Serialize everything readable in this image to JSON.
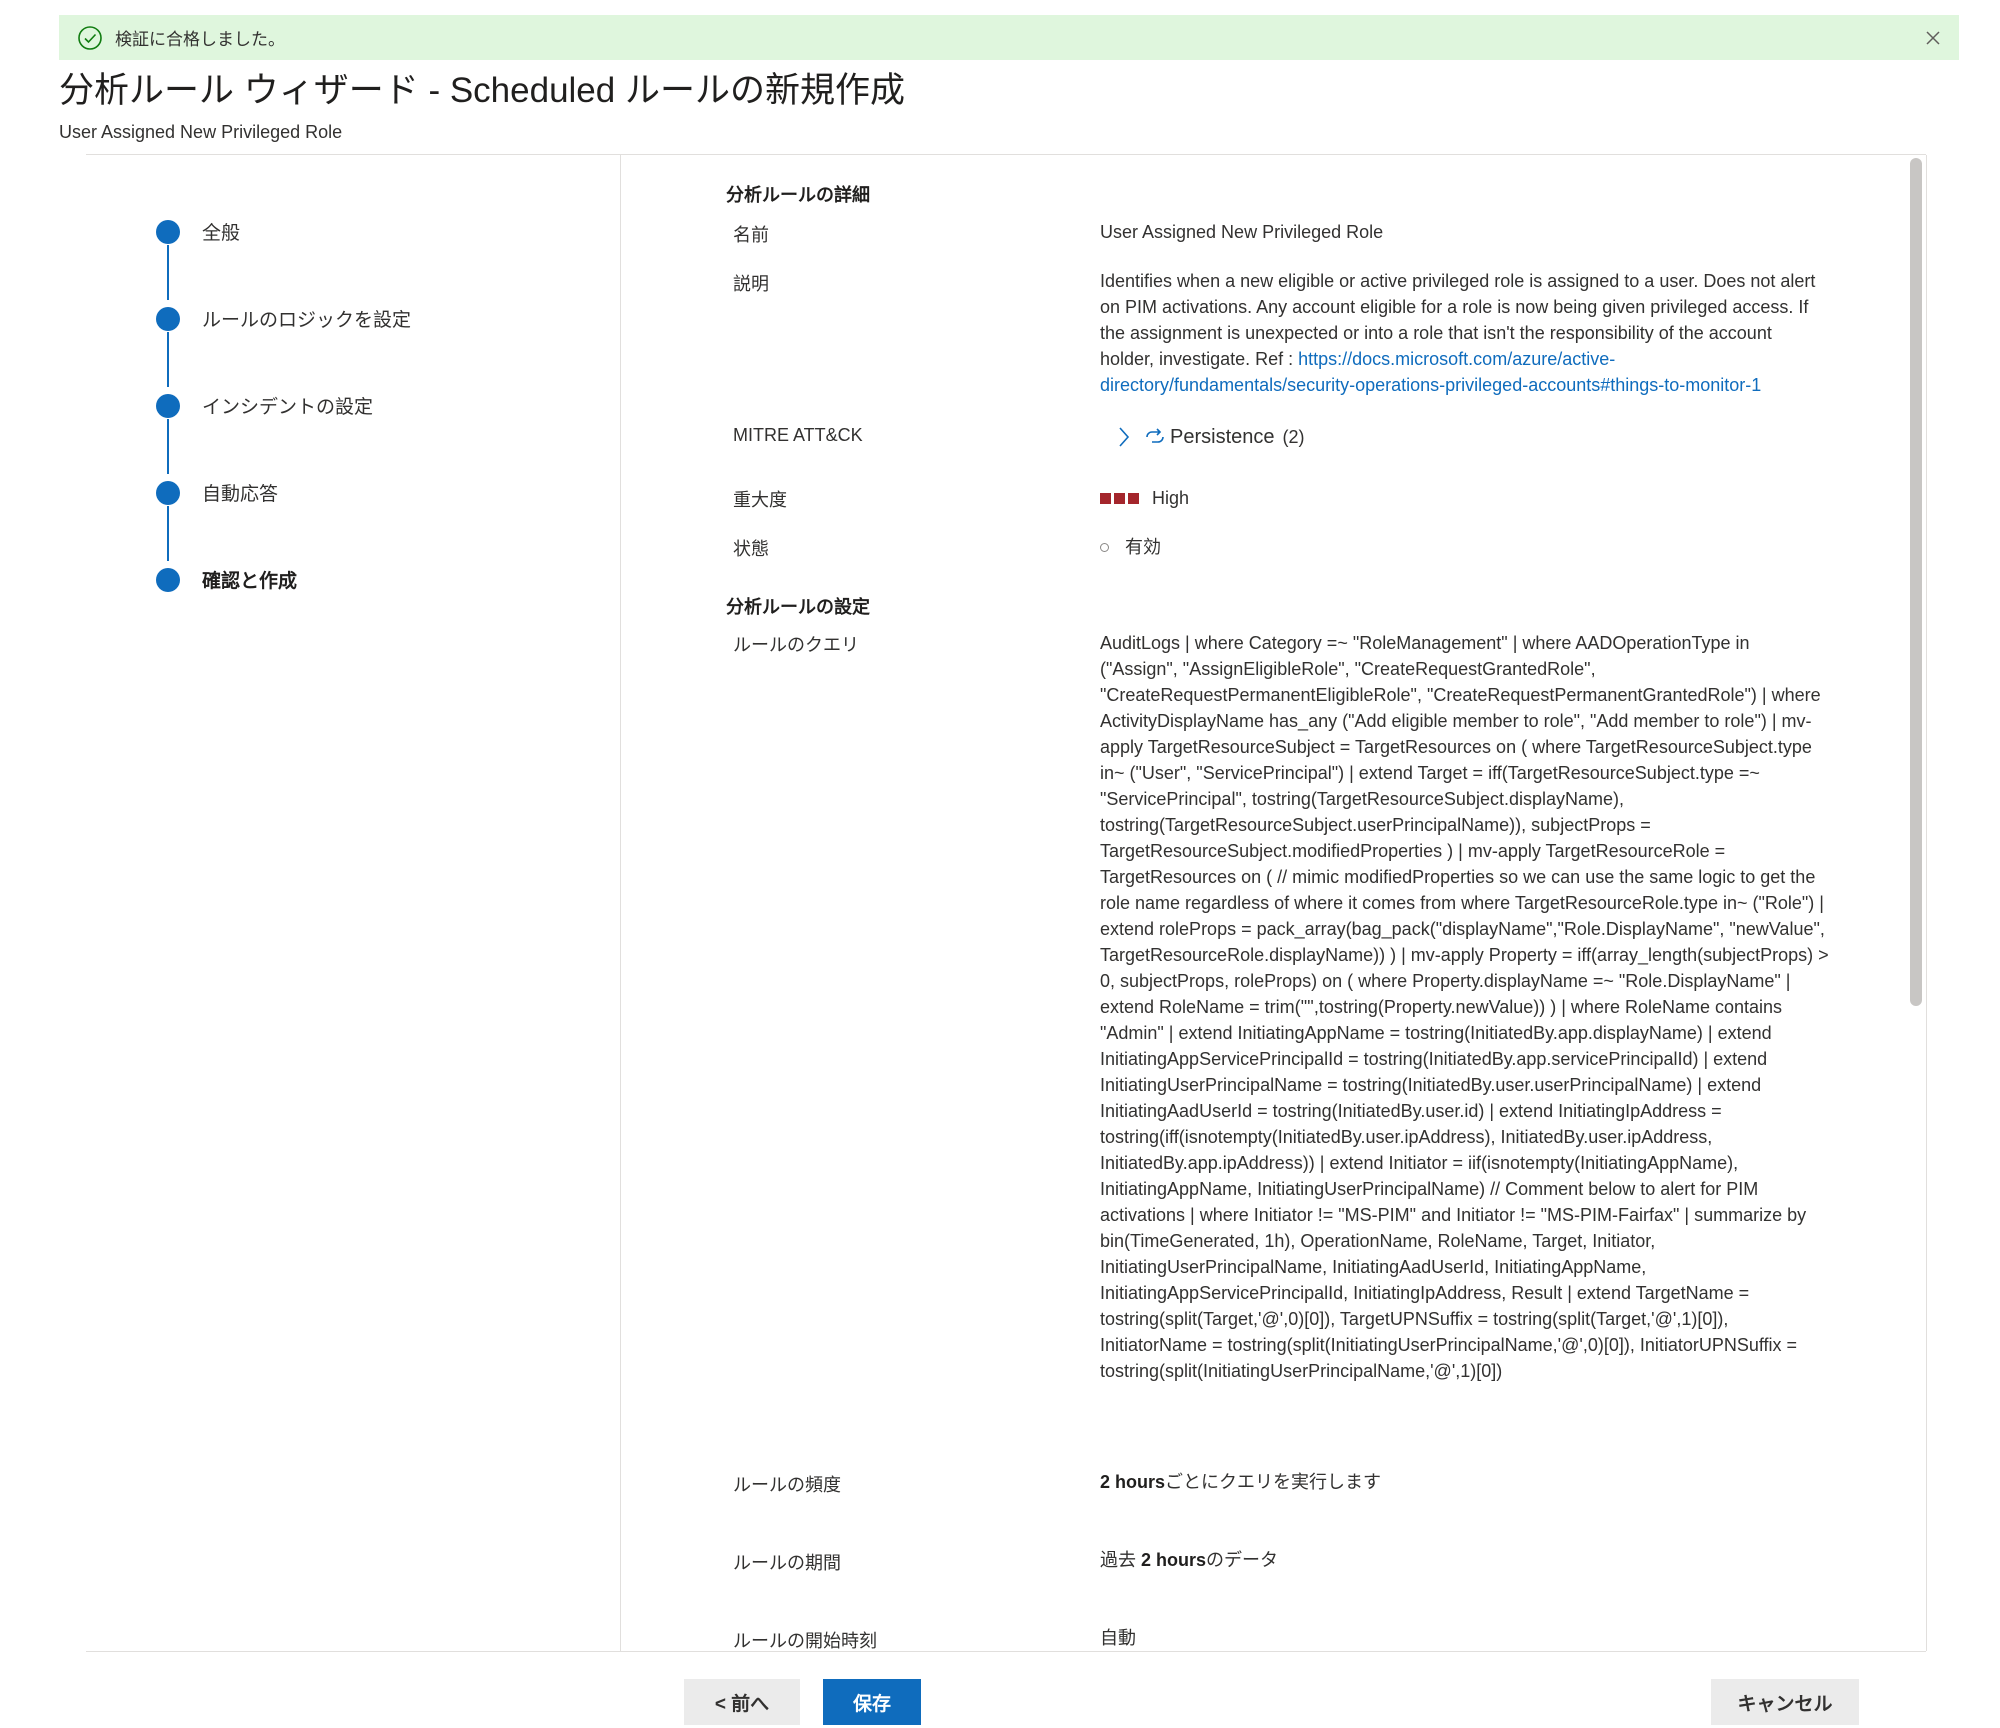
{
  "banner": {
    "message": "検証に合格しました。",
    "status_color": "#dff6dd"
  },
  "header": {
    "title": "分析ルール ウィザード - Scheduled ルールの新規作成",
    "subtitle": "User Assigned New Privileged Role"
  },
  "steps": [
    {
      "label": "全般"
    },
    {
      "label": "ルールのロジックを設定"
    },
    {
      "label": "インシデントの設定"
    },
    {
      "label": "自動応答"
    },
    {
      "label": "確認と作成"
    }
  ],
  "details": {
    "section_title": "分析ルールの詳細",
    "name_label": "名前",
    "name_value": "User Assigned New Privileged Role",
    "description_label": "説明",
    "description_text": "Identifies when a new eligible or active privileged role is assigned to a user. Does not alert on PIM activations. Any account eligible for a role is now being given privileged access. If the assignment is unexpected or into a role that isn't the responsibility of the account holder, investigate. Ref : ",
    "description_link": "https://docs.microsoft.com/azure/active-directory/fundamentals/security-operations-privileged-accounts#things-to-monitor-1",
    "mitre_label": "MITRE ATT&CK",
    "mitre_tactic": "Persistence",
    "mitre_count": "(2)",
    "severity_label": "重大度",
    "severity_value": "High",
    "severity_color": "#a4262c",
    "status_label": "状態",
    "status_value": "有効"
  },
  "settings": {
    "section_title": "分析ルールの設定",
    "query_label": "ルールのクエリ",
    "query_text": "AuditLogs | where Category =~ \"RoleManagement\" | where AADOperationType in (\"Assign\", \"AssignEligibleRole\", \"CreateRequestGrantedRole\", \"CreateRequestPermanentEligibleRole\", \"CreateRequestPermanentGrantedRole\") | where ActivityDisplayName has_any (\"Add eligible member to role\", \"Add member to role\") | mv-apply TargetResourceSubject = TargetResources on ( where TargetResourceSubject.type in~ (\"User\", \"ServicePrincipal\") | extend Target = iff(TargetResourceSubject.type =~ \"ServicePrincipal\", tostring(TargetResourceSubject.displayName), tostring(TargetResourceSubject.userPrincipalName)), subjectProps = TargetResourceSubject.modifiedProperties ) | mv-apply TargetResourceRole = TargetResources on ( // mimic modifiedProperties so we can use the same logic to get the role name regardless of where it comes from where TargetResourceRole.type in~ (\"Role\") | extend roleProps = pack_array(bag_pack(\"displayName\",\"Role.DisplayName\", \"newValue\", TargetResourceRole.displayName)) ) | mv-apply Property = iff(array_length(subjectProps) > 0, subjectProps, roleProps) on ( where Property.displayName =~ \"Role.DisplayName\" | extend RoleName = trim('\"',tostring(Property.newValue)) ) | where RoleName contains \"Admin\" | extend InitiatingAppName = tostring(InitiatedBy.app.displayName) | extend InitiatingAppServicePrincipalId = tostring(InitiatedBy.app.servicePrincipalId) | extend InitiatingUserPrincipalName = tostring(InitiatedBy.user.userPrincipalName) | extend InitiatingAadUserId = tostring(InitiatedBy.user.id) | extend InitiatingIpAddress = tostring(iff(isnotempty(InitiatedBy.user.ipAddress), InitiatedBy.user.ipAddress, InitiatedBy.app.ipAddress)) | extend Initiator = iif(isnotempty(InitiatingAppName), InitiatingAppName, InitiatingUserPrincipalName) // Comment below to alert for PIM activations | where Initiator != \"MS-PIM\" and Initiator != \"MS-PIM-Fairfax\" | summarize by bin(TimeGenerated, 1h), OperationName, RoleName, Target, Initiator, InitiatingUserPrincipalName, InitiatingAadUserId, InitiatingAppName, InitiatingAppServicePrincipalId, InitiatingIpAddress, Result | extend TargetName = tostring(split(Target,'@',0)[0]), TargetUPNSuffix = tostring(split(Target,'@',1)[0]), InitiatorName = tostring(split(InitiatingUserPrincipalName,'@',0)[0]), InitiatorUPNSuffix = tostring(split(InitiatingUserPrincipalName,'@',1)[0])",
    "frequency_label": "ルールの頻度",
    "frequency_bold": "2 hours",
    "frequency_suffix": "ごとにクエリを実行します",
    "period_label": "ルールの期間",
    "period_prefix": "過去 ",
    "period_bold": "2 hours",
    "period_suffix": "のデータ",
    "start_label": "ルールの開始時刻",
    "start_value": "自動"
  },
  "footer": {
    "prev_label": "< 前へ",
    "save_label": "保存",
    "cancel_label": "キャンセル"
  },
  "colors": {
    "accent": "#0f6cbd",
    "success": "#107c10"
  },
  "icons": {
    "banner": "checkmark-circle-icon",
    "close": "close-icon",
    "mitre_expand": "chevron-right-icon",
    "tactic": "persistence-icon"
  }
}
